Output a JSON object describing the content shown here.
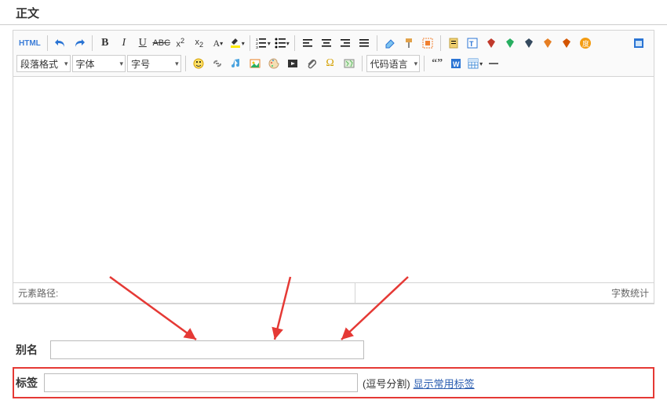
{
  "section": {
    "title": "正文"
  },
  "toolbar": {
    "html": "HTML",
    "paragraph": {
      "label": "段落格式"
    },
    "font": {
      "label": "字体"
    },
    "size": {
      "label": "字号"
    },
    "codelang": {
      "label": "代码语言"
    }
  },
  "status": {
    "path": "元素路径:",
    "wordcount": "字数统计"
  },
  "alias": {
    "label": "别名"
  },
  "tags": {
    "label": "标签",
    "hint": "(逗号分割)",
    "show_common": "显示常用标签"
  }
}
